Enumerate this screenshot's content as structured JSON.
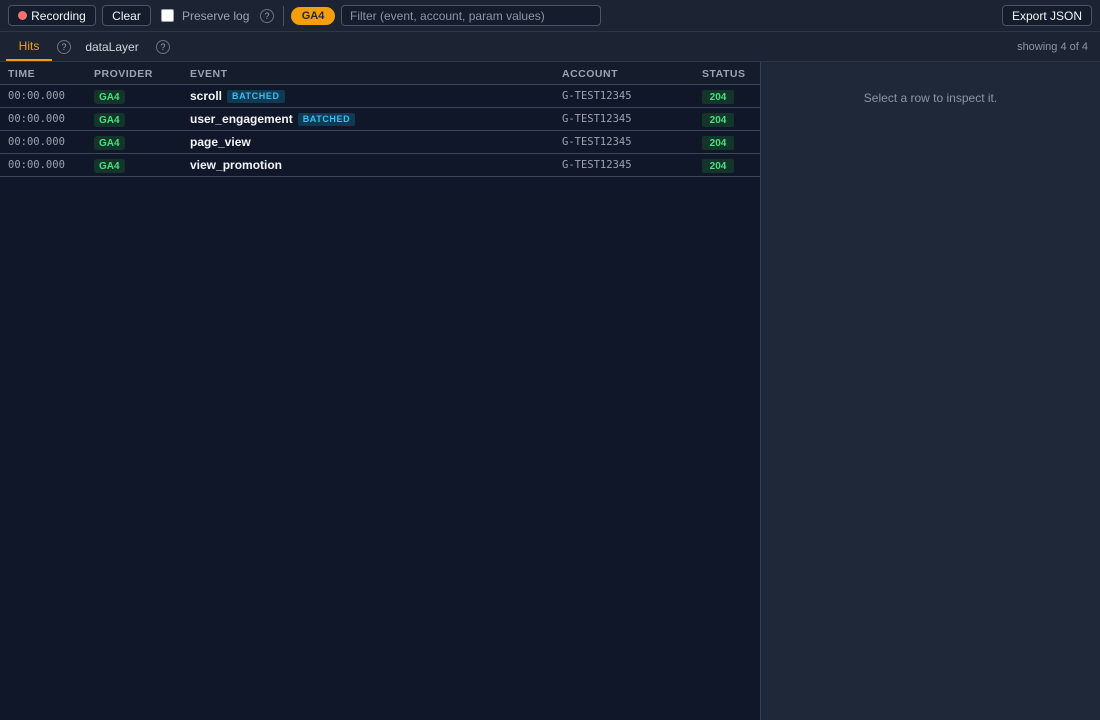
{
  "toolbar": {
    "recording_label": "Recording",
    "clear_label": "Clear",
    "preserve_log_label": "Preserve log",
    "preserve_log_checked": false,
    "help_glyph": "?",
    "provider_pill": "GA4",
    "filter_placeholder": "Filter (event, account, param values)",
    "filter_value": "",
    "export_label": "Export JSON",
    "recording_dot_color": "#f87171",
    "accent_color": "#f59e0b"
  },
  "tabs": [
    {
      "label": "Hits",
      "active": true,
      "help": "?"
    },
    {
      "label": "dataLayer",
      "active": false,
      "help": "?"
    }
  ],
  "showing_text": "showing 4 of 4",
  "table": {
    "columns": [
      "TIME",
      "PROVIDER",
      "EVENT",
      "ACCOUNT",
      "STATUS"
    ],
    "rows": [
      {
        "time": "00:00.000",
        "provider": "GA4",
        "event": "scroll",
        "tag": "BATCHED",
        "account": "G-TEST12345",
        "status": "204"
      },
      {
        "time": "00:00.000",
        "provider": "GA4",
        "event": "user_engagement",
        "tag": "BATCHED",
        "account": "G-TEST12345",
        "status": "204"
      },
      {
        "time": "00:00.000",
        "provider": "GA4",
        "event": "page_view",
        "tag": "",
        "account": "G-TEST12345",
        "status": "204"
      },
      {
        "time": "00:00.000",
        "provider": "GA4",
        "event": "view_promotion",
        "tag": "",
        "account": "G-TEST12345",
        "status": "204"
      }
    ]
  },
  "inspector": {
    "empty_message": "Select a row to inspect it."
  }
}
